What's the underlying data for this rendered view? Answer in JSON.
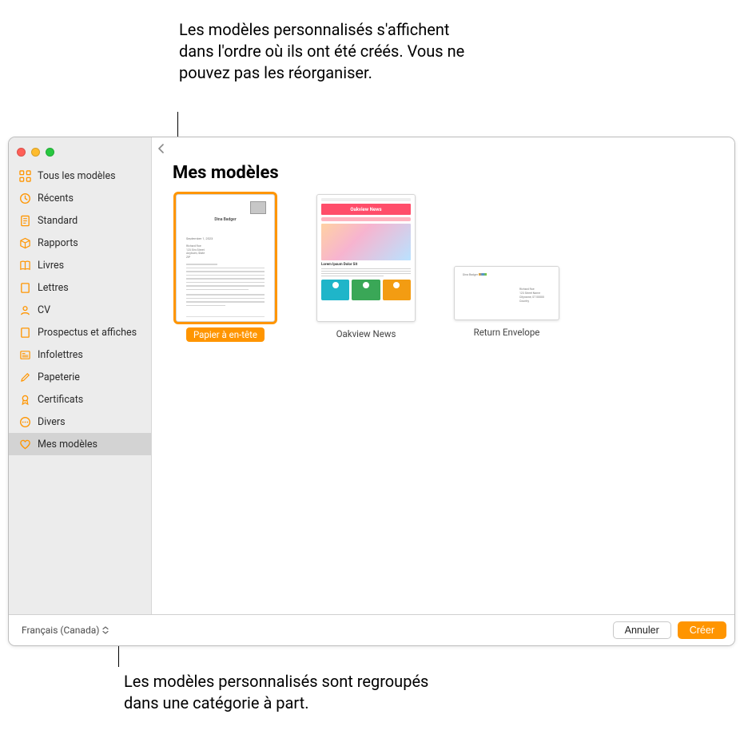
{
  "annotations": {
    "top": "Les modèles personnalisés s'affichent dans l'ordre où ils ont été créés. Vous ne pouvez pas les réorganiser.",
    "bottom": "Les modèles personnalisés sont regroupés dans une catégorie à part."
  },
  "sidebar": {
    "items": [
      {
        "label": "Tous les modèles",
        "icon": "grid"
      },
      {
        "label": "Récents",
        "icon": "clock"
      },
      {
        "label": "Standard",
        "icon": "doc"
      },
      {
        "label": "Rapports",
        "icon": "box"
      },
      {
        "label": "Livres",
        "icon": "book"
      },
      {
        "label": "Lettres",
        "icon": "page"
      },
      {
        "label": "CV",
        "icon": "user"
      },
      {
        "label": "Prospectus et affiches",
        "icon": "page"
      },
      {
        "label": "Infolettres",
        "icon": "news"
      },
      {
        "label": "Papeterie",
        "icon": "pencil"
      },
      {
        "label": "Certificats",
        "icon": "badge"
      },
      {
        "label": "Divers",
        "icon": "more"
      },
      {
        "label": "Mes modèles",
        "icon": "heart"
      }
    ],
    "active_index": 12
  },
  "content": {
    "title": "Mes modèles",
    "templates": [
      {
        "label": "Papier à en-tête",
        "selected": true,
        "kind": "letterhead"
      },
      {
        "label": "Oakview News",
        "selected": false,
        "kind": "newsletter",
        "headline": "Oakview News"
      },
      {
        "label": "Return Envelope",
        "selected": false,
        "kind": "envelope"
      }
    ]
  },
  "footer": {
    "language": "Français (Canada)",
    "cancel": "Annuler",
    "create": "Créer"
  }
}
